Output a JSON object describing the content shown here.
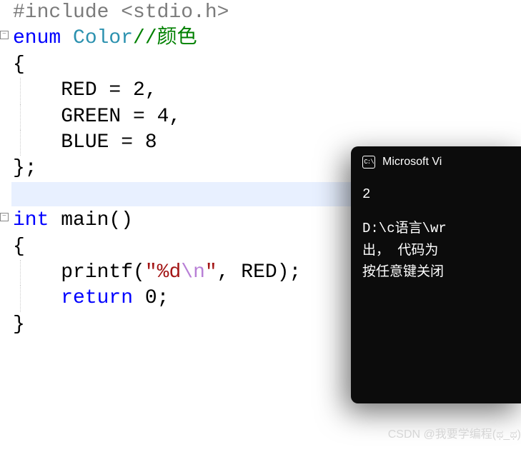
{
  "code": {
    "line1_directive": "#include ",
    "line1_path": "<stdio.h>",
    "line2_keyword": "enum",
    "line2_type": " Color",
    "line2_comment": "//颜色",
    "line3": "{",
    "line4": "    RED = 2,",
    "line5": "    GREEN = 4,",
    "line6": "    BLUE = 8",
    "line7": "};",
    "line8": "",
    "line9_type": "int",
    "line9_func": " main()",
    "line10": "{",
    "line11_func": "    printf",
    "line11_open": "(",
    "line11_str1": "\"%d",
    "line11_esc": "\\n",
    "line11_str2": "\"",
    "line11_rest": ", RED);",
    "line12_kw": "    return",
    "line12_rest": " 0;",
    "line13": "}"
  },
  "terminal": {
    "title": "Microsoft Vi",
    "icon_label": "C:\\",
    "output": "2",
    "path_line": "D:\\c语言\\wr",
    "exit_line": "出， 代码为",
    "prompt_line": "按任意键关闭"
  },
  "watermark": "CSDN @我要学编程(ಥ_ಥ)",
  "fold": "−"
}
